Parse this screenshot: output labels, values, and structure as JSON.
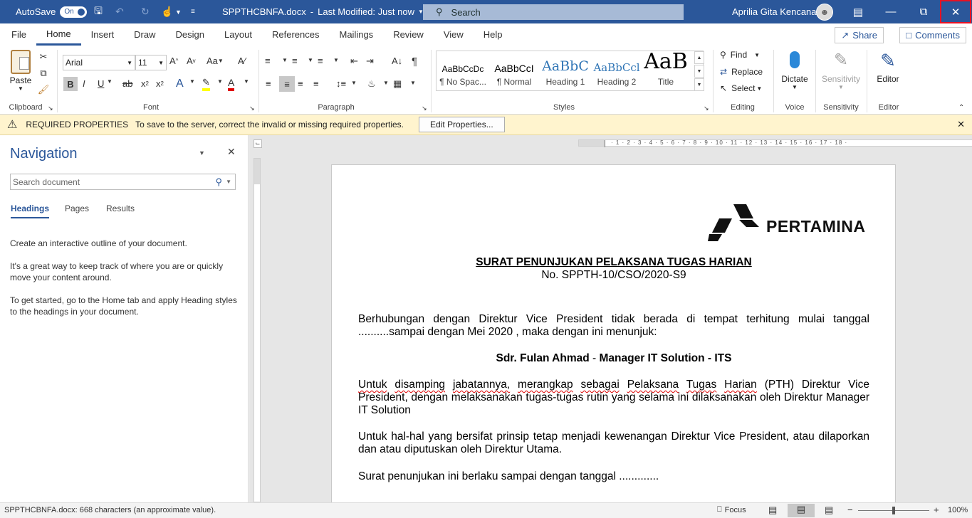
{
  "titlebar": {
    "autosave_label": "AutoSave",
    "autosave_state": "On",
    "filename": "SPPTHCBNFA.docx",
    "separator": "-",
    "last_modified": "Last Modified: Just now",
    "search_placeholder": "Search",
    "user_name": "Aprilia Gita Kencana"
  },
  "menu": {
    "tabs": [
      "File",
      "Home",
      "Insert",
      "Draw",
      "Design",
      "Layout",
      "References",
      "Mailings",
      "Review",
      "View",
      "Help"
    ],
    "share": "Share",
    "comments": "Comments"
  },
  "ribbon": {
    "clipboard": {
      "paste": "Paste",
      "label": "Clipboard"
    },
    "font": {
      "family": "Arial",
      "size": "11",
      "label": "Font"
    },
    "paragraph": {
      "label": "Paragraph"
    },
    "styles": {
      "label": "Styles",
      "items": [
        {
          "preview": "AaBbCcDc",
          "name": "¶ No Spac..."
        },
        {
          "preview": "AaBbCcI",
          "name": "¶ Normal"
        },
        {
          "preview": "AaBbC",
          "name": "Heading 1"
        },
        {
          "preview": "AaBbCcl",
          "name": "Heading 2"
        },
        {
          "preview": "AaB",
          "name": "Title"
        }
      ]
    },
    "editing": {
      "find": "Find",
      "replace": "Replace",
      "select": "Select",
      "label": "Editing"
    },
    "voice": {
      "dictate": "Dictate",
      "label": "Voice"
    },
    "sensitivity": {
      "button": "Sensitivity",
      "label": "Sensitivity"
    },
    "editor": {
      "button": "Editor",
      "label": "Editor"
    }
  },
  "infobar": {
    "title": "REQUIRED PROPERTIES",
    "message": "To save to the server, correct the invalid or missing required properties.",
    "button": "Edit Properties..."
  },
  "navigation": {
    "title": "Navigation",
    "search_placeholder": "Search document",
    "tabs": [
      "Headings",
      "Pages",
      "Results"
    ],
    "text1": "Create an interactive outline of your document.",
    "text2": "It's a great way to keep track of where you are or quickly move your content around.",
    "text3": "To get started, go to the Home tab and apply Heading styles to the headings in your document."
  },
  "document": {
    "logo_text": "PERTAMINA",
    "title": "SURAT PENUNJUKAN PELAKSANA TUGAS HARIAN",
    "number": "No. SPPTH-10/CSO/2020-S9",
    "para1": "Berhubungan dengan Direktur Vice President tidak berada di tempat terhitung mulai tanggal ..........sampai dengan Mei 2020 , maka dengan ini menunjuk:",
    "appointee_name": "Sdr. Fulan Ahmad",
    "appointee_dash": " - ",
    "appointee_role": "Manager IT Solution - ITS",
    "para3_words": [
      "Untuk",
      "disamping",
      "jabatannya,",
      "merangkap",
      "sebagai",
      "Pelaksana",
      "Tugas",
      "Harian"
    ],
    "para3_rest": "(PTH) Direktur Vice President, dengan melaksanakan tugas-tugas rutin yang selama ini dilaksanakan oleh  Direktur Manager IT Solution",
    "para4": "Untuk hal-hal yang bersifat prinsip  tetap menjadi kewenangan Direktur Vice President, atau dilaporkan dan atau diputuskan oleh Direktur Utama.",
    "para5": "Surat penunjukan ini berlaku sampai dengan tanggal ............."
  },
  "statusbar": {
    "info": "SPPTHCBNFA.docx: 668 characters (an approximate value).",
    "focus": "Focus",
    "zoom": "100%"
  },
  "colors": {
    "brand": "#2b579a",
    "infobar": "#fff4ce",
    "close_highlight": "#e81123"
  }
}
